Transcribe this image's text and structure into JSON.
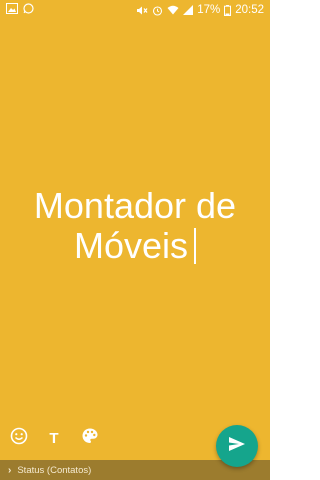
{
  "status_bar": {
    "battery_percent": "17%",
    "time": "20:52",
    "icons": [
      "image-icon",
      "whatsapp-icon",
      "mute-icon",
      "alarm-icon",
      "wifi-icon",
      "signal-icon",
      "battery-icon"
    ]
  },
  "editor": {
    "line1": "Montador de",
    "line2": "Móveis",
    "background_color": "#EDB62F",
    "text_color": "#FFFFFF"
  },
  "toolbar": {
    "emoji_icon": "emoji-icon",
    "text_tool_label": "T",
    "palette_icon": "palette-icon"
  },
  "footer": {
    "audience_label": "Status (Contatos)"
  },
  "send_button": {
    "color": "#15A58C",
    "icon": "send-icon"
  }
}
